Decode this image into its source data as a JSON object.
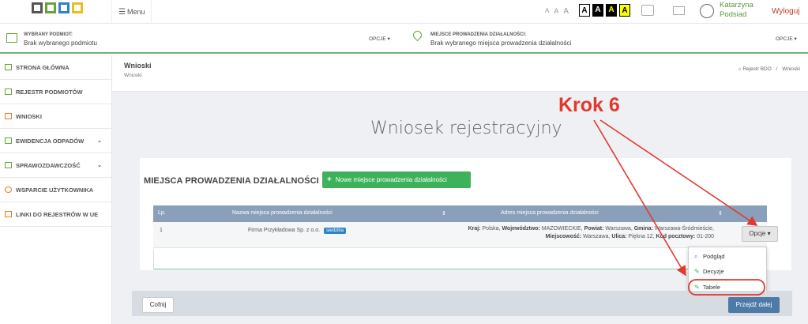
{
  "header": {
    "menu_label": "Menu",
    "font_sizes": [
      "A",
      "A",
      "A"
    ],
    "contrast_buttons": [
      "A",
      "A",
      "A",
      "A"
    ],
    "user_first": "Katarzyna",
    "user_last": "Podsiad",
    "logout_label": "Wyloguj",
    "colors": {
      "user": "#5a9a3b",
      "logout": "#c0392b"
    }
  },
  "context": {
    "entity_label": "WYBRANY PODMIOT:",
    "entity_value": "Brak wybranego podmiotu",
    "entity_options": "OPCJE",
    "place_label": "MIEJSCE PROWADZENIA DZIAŁALNOŚCI:",
    "place_value": "Brak wybranego miejsca prowadzenia działalności",
    "place_options": "OPCJE"
  },
  "sidebar": {
    "items": [
      {
        "label": "STRONA GŁÓWNA",
        "icon": "home-icon"
      },
      {
        "label": "REJESTR PODMIOTÓW",
        "icon": "cube-icon"
      },
      {
        "label": "WNIOSKI",
        "icon": "file-icon"
      },
      {
        "label": "EWIDENCJA ODPADÓW",
        "icon": "list-icon"
      },
      {
        "label": "SPRAWOZDAWCZOŚĆ",
        "icon": "report-icon"
      },
      {
        "label": "WSPARCIE UŻYTKOWNIKA",
        "icon": "support-icon"
      },
      {
        "label": "LINKI DO REJESTRÓW W UE",
        "icon": "folder-icon"
      }
    ]
  },
  "breadcrumb": {
    "title": "Wnioski",
    "subtitle": "Wnioski",
    "path_home": "Rejestr BDO",
    "path_sep": "/",
    "path_current": "Wnioski"
  },
  "main": {
    "page_title": "Wniosek rejestracyjny",
    "section_title": "MIEJSCA PROWADZENIA DZIAŁALNOŚCI",
    "new_button": "Nowe miejsce prowadzenia działalności",
    "table": {
      "headers": [
        "Lp.",
        "Nazwa miejsca prowadzenia działalności",
        "Adres miejsca prowadzenia działalności"
      ],
      "rows": [
        {
          "lp": "1",
          "name": "Firma Przykładowa Sp. z o.o.",
          "badge": "siedziba",
          "address": {
            "kraj_label": "Kraj:",
            "kraj": "Polska,",
            "woj_label": "Województwo:",
            "woj": "MAZOWIECKIE,",
            "powiat_label": "Powiat:",
            "powiat": "Warszawa,",
            "gmina_label": "Gmina:",
            "gmina": "Warszawa-Śródmieście,",
            "miejsc_label": "Miejscowość:",
            "miejsc": "Warszawa,",
            "ulica_label": "Ulica:",
            "ulica": "Piękna 12,",
            "kod_label": "Kod pocztowy:",
            "kod": "01-200"
          },
          "options_button": "Opcje"
        }
      ]
    },
    "dropdown": {
      "items": [
        {
          "label": "Podgląd",
          "icon": "search-icon"
        },
        {
          "label": "Decyzje",
          "icon": "edit-icon"
        },
        {
          "label": "Tabele",
          "icon": "edit-icon"
        }
      ]
    },
    "back_button": "Cofnij",
    "next_button": "Przejdź dalej"
  },
  "annotation": {
    "label": "Krok 6",
    "color": "#e03a2f"
  }
}
